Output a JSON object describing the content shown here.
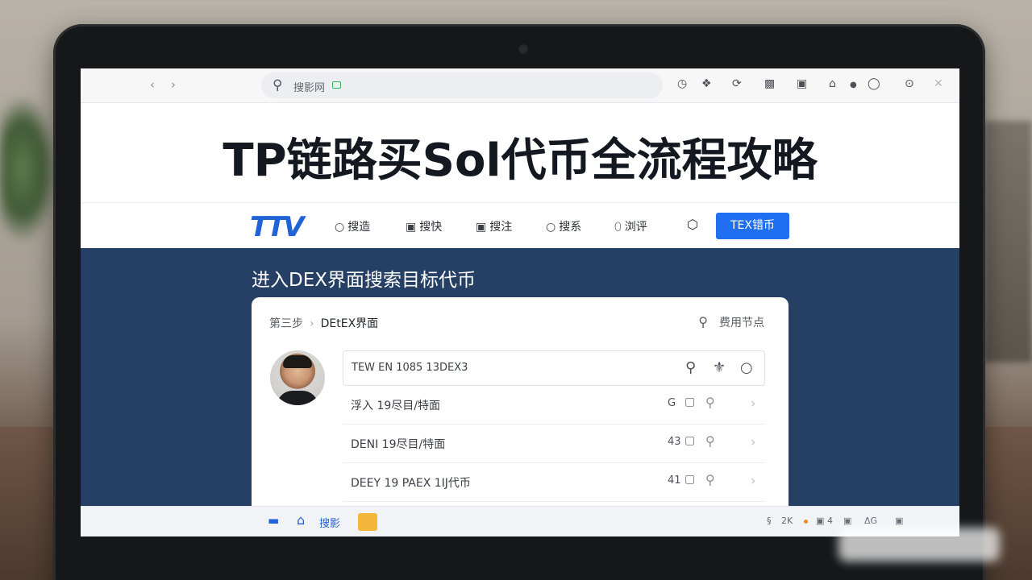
{
  "browser": {
    "nav_back": "›",
    "nav_forward": "›",
    "address_text": "搜影网",
    "toolbar_icons": [
      "clock-icon",
      "puzzle-icon",
      "refresh-icon",
      "reader-icon",
      "sidebar-icon",
      "home-icon",
      "user-icon",
      "more-icon",
      "close-icon"
    ]
  },
  "page": {
    "title": "TP链路买Sol代币全流程攻略"
  },
  "site_nav": {
    "logo": "TTV",
    "items": [
      {
        "icon": "○",
        "label": "搜造"
      },
      {
        "icon": "▣",
        "label": "搜快"
      },
      {
        "icon": "▣",
        "label": "搜注"
      },
      {
        "icon": "○",
        "label": "搜系"
      },
      {
        "icon": "⬯",
        "label": "浏评"
      }
    ],
    "cta_label": "TEX错币"
  },
  "main": {
    "section_title": "进入DEX界面搜索目标代币",
    "breadcrumb_step": "第三步",
    "breadcrumb_sep": "›",
    "breadcrumb_current": "DEtEX界面",
    "right_label": "费用节点",
    "search_value": "TEW EN 1085 13DEX3",
    "rows": [
      {
        "label": "浮入   19尽目/特面",
        "count": "G"
      },
      {
        "label": "DENI  19尽目/特面",
        "count": "43"
      },
      {
        "label": "DEEY 19 PAEX 1Ĳ代币",
        "count": "41"
      }
    ]
  },
  "taskbar": {
    "search_label": "搜影",
    "tray": [
      "§",
      "2K",
      "▣",
      "4",
      "▣",
      "ΔG",
      "▣"
    ]
  },
  "colors": {
    "accent": "#1f6ff0",
    "main_bg": "#253f65",
    "logo": "#1f63d6"
  }
}
